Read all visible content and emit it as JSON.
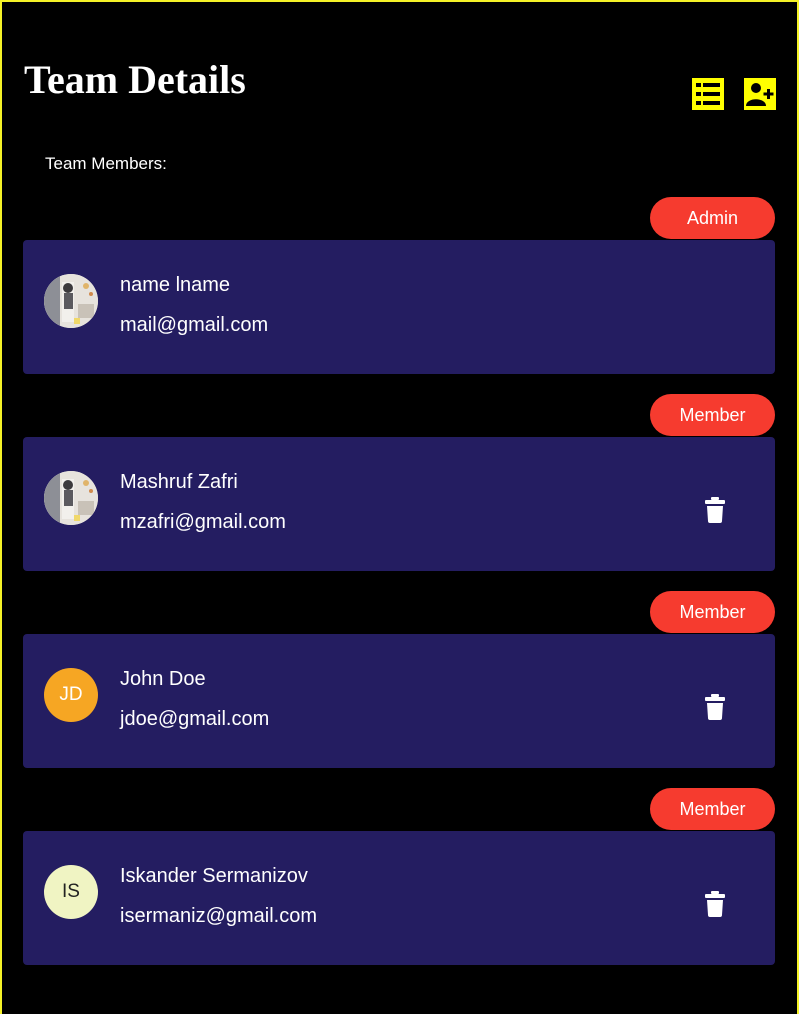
{
  "header": {
    "title": "Team Details",
    "icons": [
      "list-icon",
      "add-user-icon"
    ]
  },
  "members_label": "Team Members:",
  "members": [
    {
      "role": "Admin",
      "name": "name lname",
      "email": "mail@gmail.com",
      "avatar_type": "photo",
      "initials": "",
      "avatar_color": "",
      "deletable": false
    },
    {
      "role": "Member",
      "name": "Mashruf Zafri",
      "email": "mzafri@gmail.com",
      "avatar_type": "photo",
      "initials": "",
      "avatar_color": "",
      "deletable": true
    },
    {
      "role": "Member",
      "name": "John Doe",
      "email": "jdoe@gmail.com",
      "avatar_type": "initials",
      "initials": "JD",
      "avatar_color": "#f6a623",
      "deletable": true
    },
    {
      "role": "Member",
      "name": "Iskander Sermanizov",
      "email": "isermaniz@gmail.com",
      "avatar_type": "initials",
      "initials": "IS",
      "avatar_color": "#f0f4c3",
      "deletable": true
    }
  ],
  "colors": {
    "background": "#000000",
    "frame_border": "#f5f227",
    "accent_icons": "#ffff00",
    "card": "#241d61",
    "badge": "#f63b2f",
    "text": "#ffffff"
  }
}
